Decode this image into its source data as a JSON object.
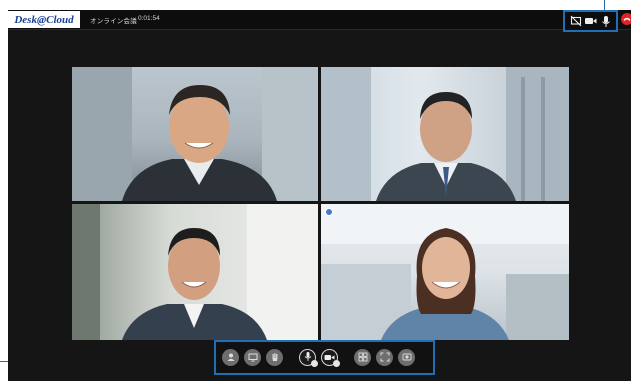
{
  "app": {
    "logo_text": "Desk@Cloud",
    "meeting_title": "オンライン会議",
    "elapsed_time": "0:01:54",
    "accent_color": "#1f6fb2",
    "hangup_color": "#e02424"
  },
  "top_controls": [
    {
      "name": "screen-off-icon",
      "interactable": true
    },
    {
      "name": "camera-icon",
      "interactable": true
    },
    {
      "name": "microphone-icon",
      "interactable": true
    }
  ],
  "participants": [
    {
      "position": "top-left",
      "description": "man in suit, smiling"
    },
    {
      "position": "top-right",
      "description": "man in suit, looking down"
    },
    {
      "position": "bottom-left",
      "description": "young man in suit"
    },
    {
      "position": "bottom-right",
      "description": "woman, smiling",
      "pinned": true
    }
  ],
  "toolbar": [
    {
      "name": "participants-icon"
    },
    {
      "name": "screen-share-icon"
    },
    {
      "name": "raise-hand-icon"
    },
    {
      "name": "microphone-toggle-icon"
    },
    {
      "name": "camera-toggle-icon"
    },
    {
      "name": "grid-layout-icon"
    },
    {
      "name": "fullscreen-icon"
    },
    {
      "name": "record-icon"
    }
  ]
}
